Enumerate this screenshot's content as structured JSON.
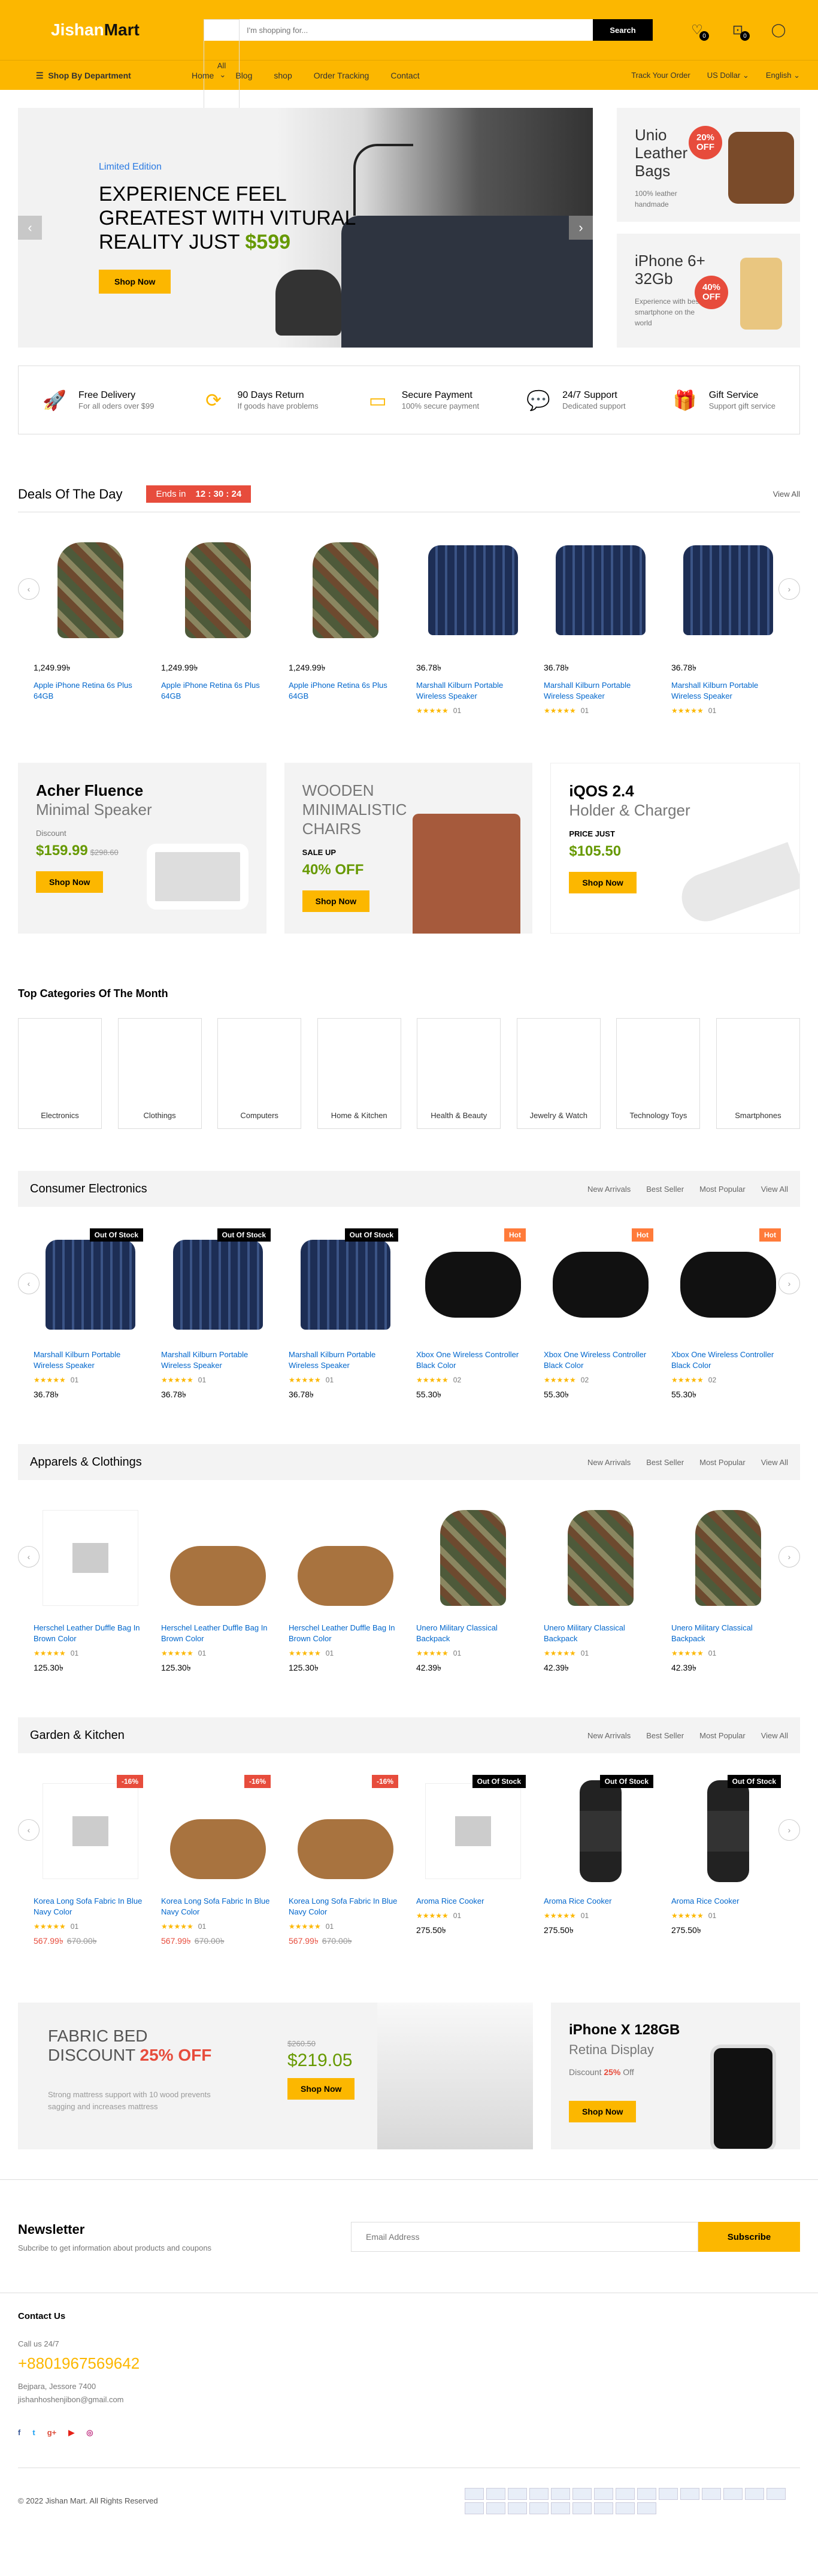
{
  "header": {
    "logo_a": "Jishan",
    "logo_b": "Mart",
    "search_cat": "All",
    "search_placeholder": "I'm shopping for...",
    "search_btn": "Search",
    "wishlist_count": "0",
    "cart_count": "0"
  },
  "nav": {
    "dept": "Shop By Department",
    "items": [
      "Home",
      "Blog",
      "shop",
      "Order Tracking",
      "Contact"
    ],
    "track": "Track Your Order",
    "currency": "US Dollar",
    "lang": "English"
  },
  "hero": {
    "tag": "Limited Edition",
    "line1": "EXPERIENCE FEEL",
    "line2": "GREATEST WITH VITURAL",
    "line3": "REALITY JUST",
    "price": "$599",
    "btn": "Shop Now"
  },
  "side": [
    {
      "title": "Unio Leather Bags",
      "off": "20% OFF",
      "desc": "100% leather handmade"
    },
    {
      "title": "iPhone 6+ 32Gb",
      "off": "40% OFF",
      "desc": "Experience with best smartphone on the world"
    }
  ],
  "features": [
    {
      "t": "Free Delivery",
      "s": "For all oders over $99"
    },
    {
      "t": "90 Days Return",
      "s": "If goods have problems"
    },
    {
      "t": "Secure Payment",
      "s": "100% secure payment"
    },
    {
      "t": "24/7 Support",
      "s": "Dedicated support"
    },
    {
      "t": "Gift Service",
      "s": "Support gift service"
    }
  ],
  "deals": {
    "title": "Deals Of The Day",
    "ends": "Ends in",
    "timer": "12 : 30 : 24",
    "view": "View All",
    "products": [
      {
        "price": "1,249.99৳",
        "name": "Apple iPhone Retina 6s Plus 64GB"
      },
      {
        "price": "1,249.99৳",
        "name": "Apple iPhone Retina 6s Plus 64GB"
      },
      {
        "price": "1,249.99৳",
        "name": "Apple iPhone Retina 6s Plus 64GB"
      },
      {
        "price": "36.78৳",
        "name": "Marshall Kilburn Portable Wireless Speaker",
        "count": "01"
      },
      {
        "price": "36.78৳",
        "name": "Marshall Kilburn Portable Wireless Speaker",
        "count": "01"
      },
      {
        "price": "36.78৳",
        "name": "Marshall Kilburn Portable Wireless Speaker",
        "count": "01"
      }
    ]
  },
  "promos": [
    {
      "title_a": "Acher Fluence",
      "title_b": "Minimal Speaker",
      "small": "Discount",
      "price": "$159.99",
      "old": "$298.60",
      "btn": "Shop Now"
    },
    {
      "title_a": "WOODEN MINIMALISTIC CHAIRS",
      "small": "SALE UP",
      "price": "40% OFF",
      "btn": "Shop Now"
    },
    {
      "title_a": "iQOS 2.4",
      "title_b": "Holder & Charger",
      "small": "PRICE JUST",
      "price": "$105.50",
      "btn": "Shop Now"
    }
  ],
  "categories": {
    "title": "Top Categories Of The Month",
    "items": [
      "Electronics",
      "Clothings",
      "Computers",
      "Home & Kitchen",
      "Health & Beauty",
      "Jewelry & Watch",
      "Technology Toys",
      "Smartphones"
    ]
  },
  "tabs": [
    "New Arrivals",
    "Best Seller",
    "Most Popular",
    "View All"
  ],
  "modules": [
    {
      "title": "Consumer Electronics",
      "products": [
        {
          "tag": "Out Of Stock",
          "name": "Marshall Kilburn Portable Wireless Speaker",
          "count": "01",
          "price": "36.78৳"
        },
        {
          "tag": "Out Of Stock",
          "name": "Marshall Kilburn Portable Wireless Speaker",
          "count": "01",
          "price": "36.78৳"
        },
        {
          "tag": "Out Of Stock",
          "name": "Marshall Kilburn Portable Wireless Speaker",
          "count": "01",
          "price": "36.78৳"
        },
        {
          "tag": "Hot",
          "name": "Xbox One Wireless Controller Black Color",
          "count": "02",
          "price": "55.30৳"
        },
        {
          "tag": "Hot",
          "name": "Xbox One Wireless Controller Black Color",
          "count": "02",
          "price": "55.30৳"
        },
        {
          "tag": "Hot",
          "name": "Xbox One Wireless Controller Black Color",
          "count": "02",
          "price": "55.30৳"
        }
      ]
    },
    {
      "title": "Apparels & Clothings",
      "products": [
        {
          "name": "Herschel Leather Duffle Bag In Brown Color",
          "count": "01",
          "price": "125.30৳"
        },
        {
          "name": "Herschel Leather Duffle Bag In Brown Color",
          "count": "01",
          "price": "125.30৳"
        },
        {
          "name": "Herschel Leather Duffle Bag In Brown Color",
          "count": "01",
          "price": "125.30৳"
        },
        {
          "name": "Unero Military Classical Backpack",
          "count": "01",
          "price": "42.39৳"
        },
        {
          "name": "Unero Military Classical Backpack",
          "count": "01",
          "price": "42.39৳"
        },
        {
          "name": "Unero Military Classical Backpack",
          "count": "01",
          "price": "42.39৳"
        }
      ]
    },
    {
      "title": "Garden & Kitchen",
      "products": [
        {
          "tag": "-16%",
          "name": "Korea Long Sofa Fabric In Blue Navy Color",
          "count": "01",
          "price": "567.99৳",
          "old": "670.00৳"
        },
        {
          "tag": "-16%",
          "name": "Korea Long Sofa Fabric In Blue Navy Color",
          "count": "01",
          "price": "567.99৳",
          "old": "670.00৳"
        },
        {
          "tag": "-16%",
          "name": "Korea Long Sofa Fabric In Blue Navy Color",
          "count": "01",
          "price": "567.99৳",
          "old": "670.00৳"
        },
        {
          "tag": "Out Of Stock",
          "name": "Aroma Rice Cooker",
          "count": "01",
          "price": "275.50৳"
        },
        {
          "tag": "Out Of Stock",
          "name": "Aroma Rice Cooker",
          "count": "01",
          "price": "275.50৳"
        },
        {
          "tag": "Out Of Stock",
          "name": "Aroma Rice Cooker",
          "count": "01",
          "price": "275.50৳"
        }
      ]
    }
  ],
  "bottom": {
    "b1_a": "FABRIC BED",
    "b1_b": "DISCOUNT",
    "b1_off": "25% OFF",
    "b1_desc": "Strong mattress support with 10 wood prevents sagging and increases mattress",
    "b1_old": "$260.50",
    "b1_price": "$219.05",
    "b1_btn": "Shop Now",
    "b2_title": "iPhone X 128GB",
    "b2_sub": "Retina Display",
    "b2_disc": "Discount",
    "b2_off": "25%",
    "b2_offsuffix": "Off",
    "b2_btn": "Shop Now"
  },
  "newsletter": {
    "title": "Newsletter",
    "desc": "Subcribe to get information about products and coupons",
    "placeholder": "Email Address",
    "btn": "Subscribe"
  },
  "footer": {
    "title": "Contact Us",
    "call": "Call us 24/7",
    "phone": "+8801967569642",
    "addr": "Bejpara, Jessore 7400",
    "email": "jishanhoshenjibon@gmail.com",
    "copy": "© 2022 Jishan Mart. All Rights Reserved"
  }
}
